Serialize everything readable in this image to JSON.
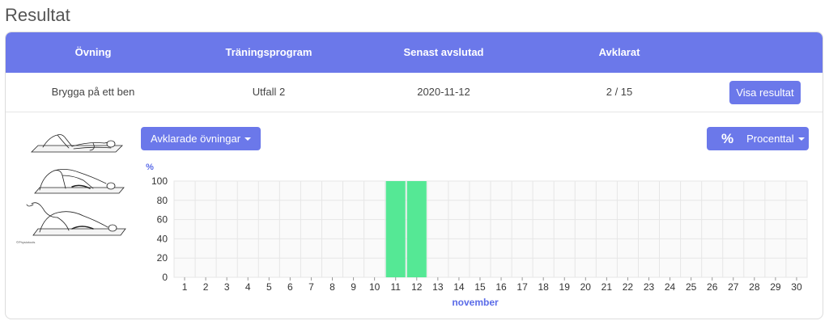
{
  "page": {
    "title": "Resultat"
  },
  "table": {
    "headers": [
      "Övning",
      "Träningsprogram",
      "Senast avslutad",
      "Avklarat"
    ],
    "row": {
      "exercise": "Brygga på ett ben",
      "program": "Utfall 2",
      "last_completed": "2020-11-12",
      "completed": "2 / 15",
      "button_label": "Visa resultat"
    }
  },
  "controls": {
    "dropdown_label": "Avklarade övningar",
    "percent_symbol": "%",
    "mode_label": "Procenttal"
  },
  "illustration": {
    "credit": "©Physiotools"
  },
  "colors": {
    "accent": "#6b78ea",
    "bar": "#55e895",
    "header_text": "#ffffff"
  },
  "chart_data": {
    "type": "bar",
    "ylabel": "%",
    "xlabel": "november",
    "ylim": [
      0,
      100
    ],
    "yticks": [
      0,
      20,
      40,
      60,
      80,
      100
    ],
    "categories": [
      "1",
      "2",
      "3",
      "4",
      "5",
      "6",
      "7",
      "8",
      "9",
      "10",
      "11",
      "12",
      "13",
      "14",
      "15",
      "16",
      "17",
      "18",
      "19",
      "20",
      "21",
      "22",
      "23",
      "24",
      "25",
      "26",
      "27",
      "28",
      "29",
      "30"
    ],
    "values": [
      0,
      0,
      0,
      0,
      0,
      0,
      0,
      0,
      0,
      0,
      100,
      100,
      0,
      0,
      0,
      0,
      0,
      0,
      0,
      0,
      0,
      0,
      0,
      0,
      0,
      0,
      0,
      0,
      0,
      0
    ],
    "grid": true
  }
}
